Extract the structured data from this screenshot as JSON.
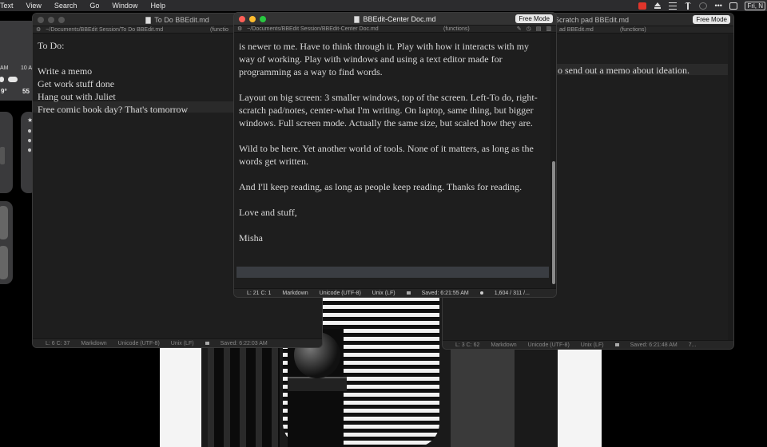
{
  "menubar": {
    "items": [
      "Text",
      "View",
      "Search",
      "Go",
      "Window",
      "Help"
    ],
    "date_fragment": "Fri, N",
    "icons": [
      "screen-record-icon",
      "eject-icon",
      "lines-icon",
      "antenna-icon",
      "clock-icon",
      "more-dots-icon",
      "control-center-icon"
    ]
  },
  "widgets": {
    "weather": {
      "hour_1": "AM",
      "hour_2": "10 A",
      "temp_1": "9°",
      "temp_2": "55"
    }
  },
  "left_window": {
    "title": "To Do BBEdit.md",
    "path": "~/Documents/BBEdit Session/To Do BBEdit.md",
    "functions": "(functio",
    "lines": [
      "To Do:",
      "",
      "Write a memo",
      "Get work stuff done",
      "Hang out with Juliet",
      "Free comic book day? That's tomorrow"
    ],
    "status": {
      "position": "L: 6 C: 37",
      "language": "Markdown",
      "encoding": "Unicode (UTF-8)",
      "line_endings": "Unix (LF)",
      "saved": "Saved: 6:22:03 AM"
    }
  },
  "right_window": {
    "title": "Scratch pad BBEdit.md",
    "path": "ad BBEdit.md",
    "functions": "(functions)",
    "free_mode": "Free Mode",
    "visible_line": "o send out a memo about ideation.",
    "status": {
      "position": "L: 3 C: 62",
      "language": "Markdown",
      "encoding": "Unicode (UTF-8)",
      "line_endings": "Unix (LF)",
      "saved": "Saved: 6:21:48 AM",
      "counts": "7..."
    }
  },
  "center_window": {
    "title": "BBEdit-Center Doc.md",
    "path": "~/Documents/BBEdit Session/BBEdit-Center Doc.md",
    "functions": "(functions)",
    "free_mode": "Free Mode",
    "paragraphs": [
      "is newer to me. Have to think through it. Play with how it interacts with my way of working. Play with windows and using a text editor made for programming as a way to find words.",
      "Layout on big screen: 3 smaller windows, top of the screen. Left-To do, right-scratch pad/notes, center-what I'm writing. On laptop, same thing, but bigger windows. Full screen mode. Actually the same size, but scaled how they are.",
      "Wild to be here. Yet another world of tools. None of it matters, as long as the words get written.",
      "And I'll keep reading, as long as people keep reading. Thanks for reading.",
      "Love and stuff,",
      "Misha"
    ],
    "status": {
      "position": "L: 21 C: 1",
      "language": "Markdown",
      "encoding": "Unicode (UTF-8)",
      "line_endings": "Unix (LF)",
      "saved": "Saved: 6:21:55 AM",
      "counts": "1,604 / 311 /..."
    },
    "scroll_position": 0.55
  }
}
